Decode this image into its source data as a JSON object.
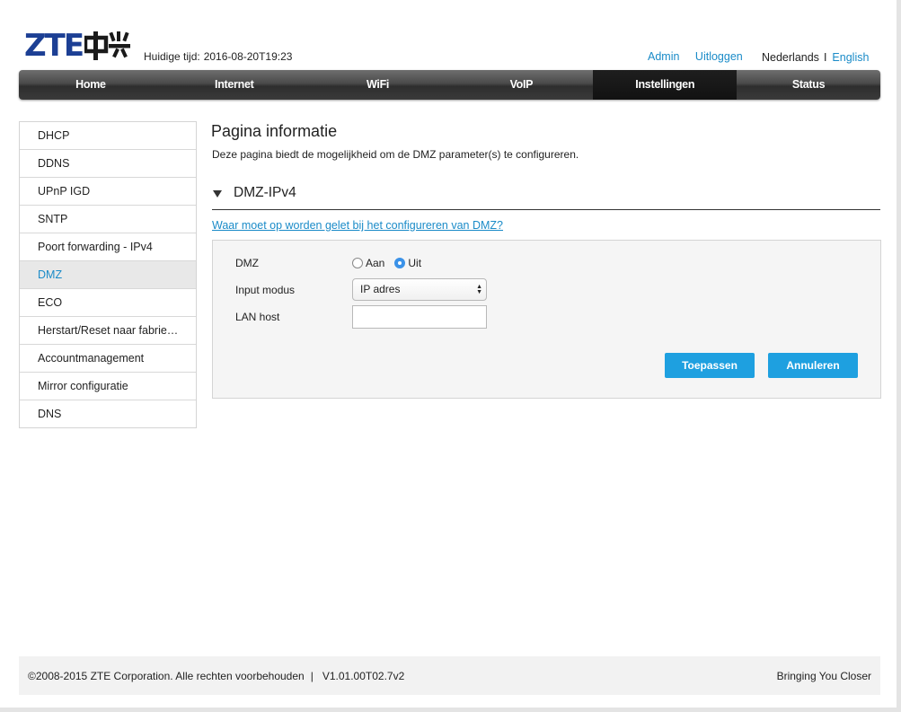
{
  "header": {
    "logo_text": "ZTE中兴",
    "time_label": "Huidige tijd:",
    "time_value": "2016-08-20T19:23",
    "admin_label": "Admin",
    "logout_label": "Uitloggen",
    "lang_current": "Nederlands",
    "lang_separator": "I",
    "lang_other": "English"
  },
  "nav": {
    "items": [
      {
        "label": "Home"
      },
      {
        "label": "Internet"
      },
      {
        "label": "WiFi"
      },
      {
        "label": "VoIP"
      },
      {
        "label": "Instellingen"
      },
      {
        "label": "Status"
      }
    ],
    "active": "Instellingen"
  },
  "sidebar": {
    "items": [
      {
        "label": "DHCP"
      },
      {
        "label": "DDNS"
      },
      {
        "label": "UPnP IGD"
      },
      {
        "label": "SNTP"
      },
      {
        "label": "Poort forwarding - IPv4"
      },
      {
        "label": "DMZ"
      },
      {
        "label": "ECO"
      },
      {
        "label": "Herstart/Reset naar fabrie…"
      },
      {
        "label": "Accountmanagement"
      },
      {
        "label": "Mirror configuratie"
      },
      {
        "label": "DNS"
      }
    ],
    "active": "DMZ"
  },
  "main": {
    "title": "Pagina informatie",
    "description": "Deze pagina biedt de mogelijkheid om de DMZ parameter(s) te configureren.",
    "section_title": "DMZ-IPv4",
    "help_link": "Waar moet op worden gelet bij het configureren van DMZ?",
    "form": {
      "dmz_label": "DMZ",
      "dmz_on_label": "Aan",
      "dmz_off_label": "Uit",
      "dmz_value": "Uit",
      "input_mode_label": "Input modus",
      "input_mode_value": "IP adres",
      "lan_host_label": "LAN host",
      "lan_host_value": "",
      "apply_label": "Toepassen",
      "cancel_label": "Annuleren"
    }
  },
  "footer": {
    "copyright": "©2008-2015 ZTE Corporation. Alle rechten voorbehouden",
    "separator": "|",
    "version": "V1.01.00T02.7v2",
    "slogan": "Bringing You Closer"
  },
  "colors": {
    "accent": "#1a8bc8",
    "button": "#1ea0e0",
    "logo": "#1c3f94",
    "nav_dark": "#2e2e2e"
  }
}
